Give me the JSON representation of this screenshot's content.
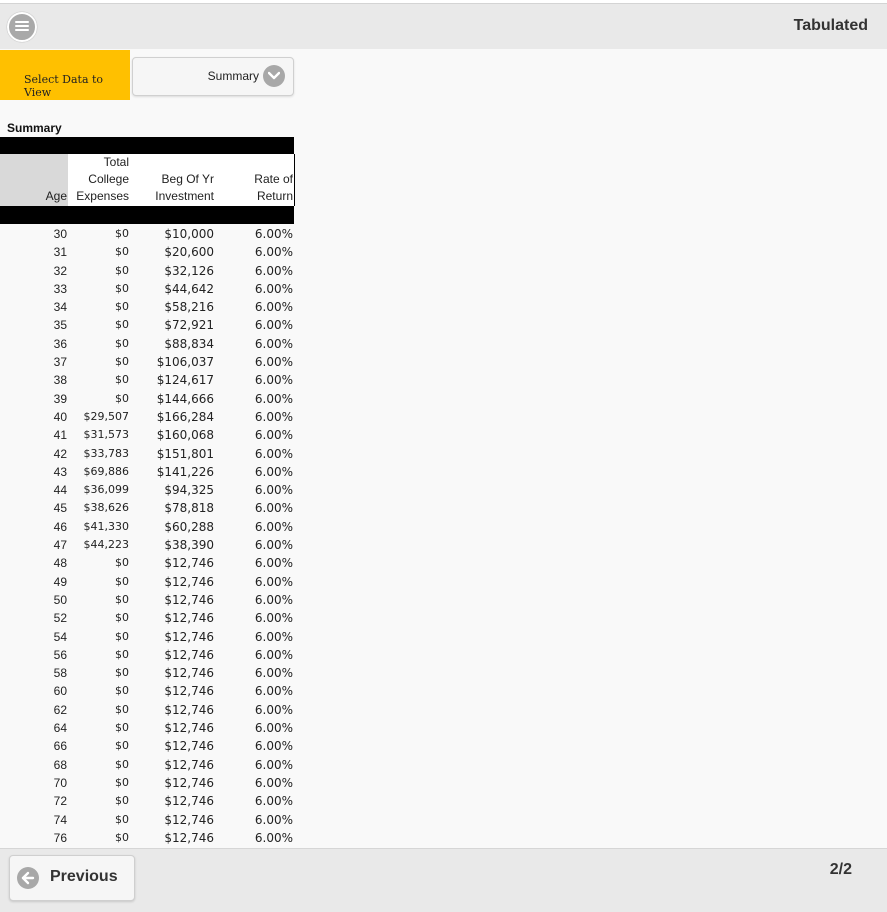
{
  "header": {
    "title": "Tabulated"
  },
  "selector": {
    "label": "Select Data to View",
    "value": "Summary"
  },
  "section": {
    "title": "Summary"
  },
  "table": {
    "columns": {
      "age": [
        "",
        "",
        "Age"
      ],
      "expenses": [
        "Total",
        "College",
        "Expenses"
      ],
      "investment": [
        "",
        "Beg Of Yr",
        "Investment"
      ],
      "return": [
        "",
        "Rate of",
        "Return"
      ]
    },
    "rows": [
      [
        "30",
        "$0",
        "$10,000",
        "6.00%"
      ],
      [
        "31",
        "$0",
        "$20,600",
        "6.00%"
      ],
      [
        "32",
        "$0",
        "$32,126",
        "6.00%"
      ],
      [
        "33",
        "$0",
        "$44,642",
        "6.00%"
      ],
      [
        "34",
        "$0",
        "$58,216",
        "6.00%"
      ],
      [
        "35",
        "$0",
        "$72,921",
        "6.00%"
      ],
      [
        "36",
        "$0",
        "$88,834",
        "6.00%"
      ],
      [
        "37",
        "$0",
        "$106,037",
        "6.00%"
      ],
      [
        "38",
        "$0",
        "$124,617",
        "6.00%"
      ],
      [
        "39",
        "$0",
        "$144,666",
        "6.00%"
      ],
      [
        "40",
        "$29,507",
        "$166,284",
        "6.00%"
      ],
      [
        "41",
        "$31,573",
        "$160,068",
        "6.00%"
      ],
      [
        "42",
        "$33,783",
        "$151,801",
        "6.00%"
      ],
      [
        "43",
        "$69,886",
        "$141,226",
        "6.00%"
      ],
      [
        "44",
        "$36,099",
        "$94,325",
        "6.00%"
      ],
      [
        "45",
        "$38,626",
        "$78,818",
        "6.00%"
      ],
      [
        "46",
        "$41,330",
        "$60,288",
        "6.00%"
      ],
      [
        "47",
        "$44,223",
        "$38,390",
        "6.00%"
      ],
      [
        "48",
        "$0",
        "$12,746",
        "6.00%"
      ],
      [
        "49",
        "$0",
        "$12,746",
        "6.00%"
      ],
      [
        "50",
        "$0",
        "$12,746",
        "6.00%"
      ],
      [
        "52",
        "$0",
        "$12,746",
        "6.00%"
      ],
      [
        "54",
        "$0",
        "$12,746",
        "6.00%"
      ],
      [
        "56",
        "$0",
        "$12,746",
        "6.00%"
      ],
      [
        "58",
        "$0",
        "$12,746",
        "6.00%"
      ],
      [
        "60",
        "$0",
        "$12,746",
        "6.00%"
      ],
      [
        "62",
        "$0",
        "$12,746",
        "6.00%"
      ],
      [
        "64",
        "$0",
        "$12,746",
        "6.00%"
      ],
      [
        "66",
        "$0",
        "$12,746",
        "6.00%"
      ],
      [
        "68",
        "$0",
        "$12,746",
        "6.00%"
      ],
      [
        "70",
        "$0",
        "$12,746",
        "6.00%"
      ],
      [
        "72",
        "$0",
        "$12,746",
        "6.00%"
      ],
      [
        "74",
        "$0",
        "$12,746",
        "6.00%"
      ],
      [
        "76",
        "$0",
        "$12,746",
        "6.00%"
      ]
    ]
  },
  "footer": {
    "previous_label": "Previous",
    "page_indicator": "2/2"
  },
  "icons": {
    "menu": "menu-icon",
    "dropdown": "chevron-down-icon",
    "previous": "arrow-left-icon"
  },
  "colors": {
    "accent": "#ffc000",
    "header_bg": "#e9e9e9",
    "icon_gray": "#a8a8a8"
  }
}
